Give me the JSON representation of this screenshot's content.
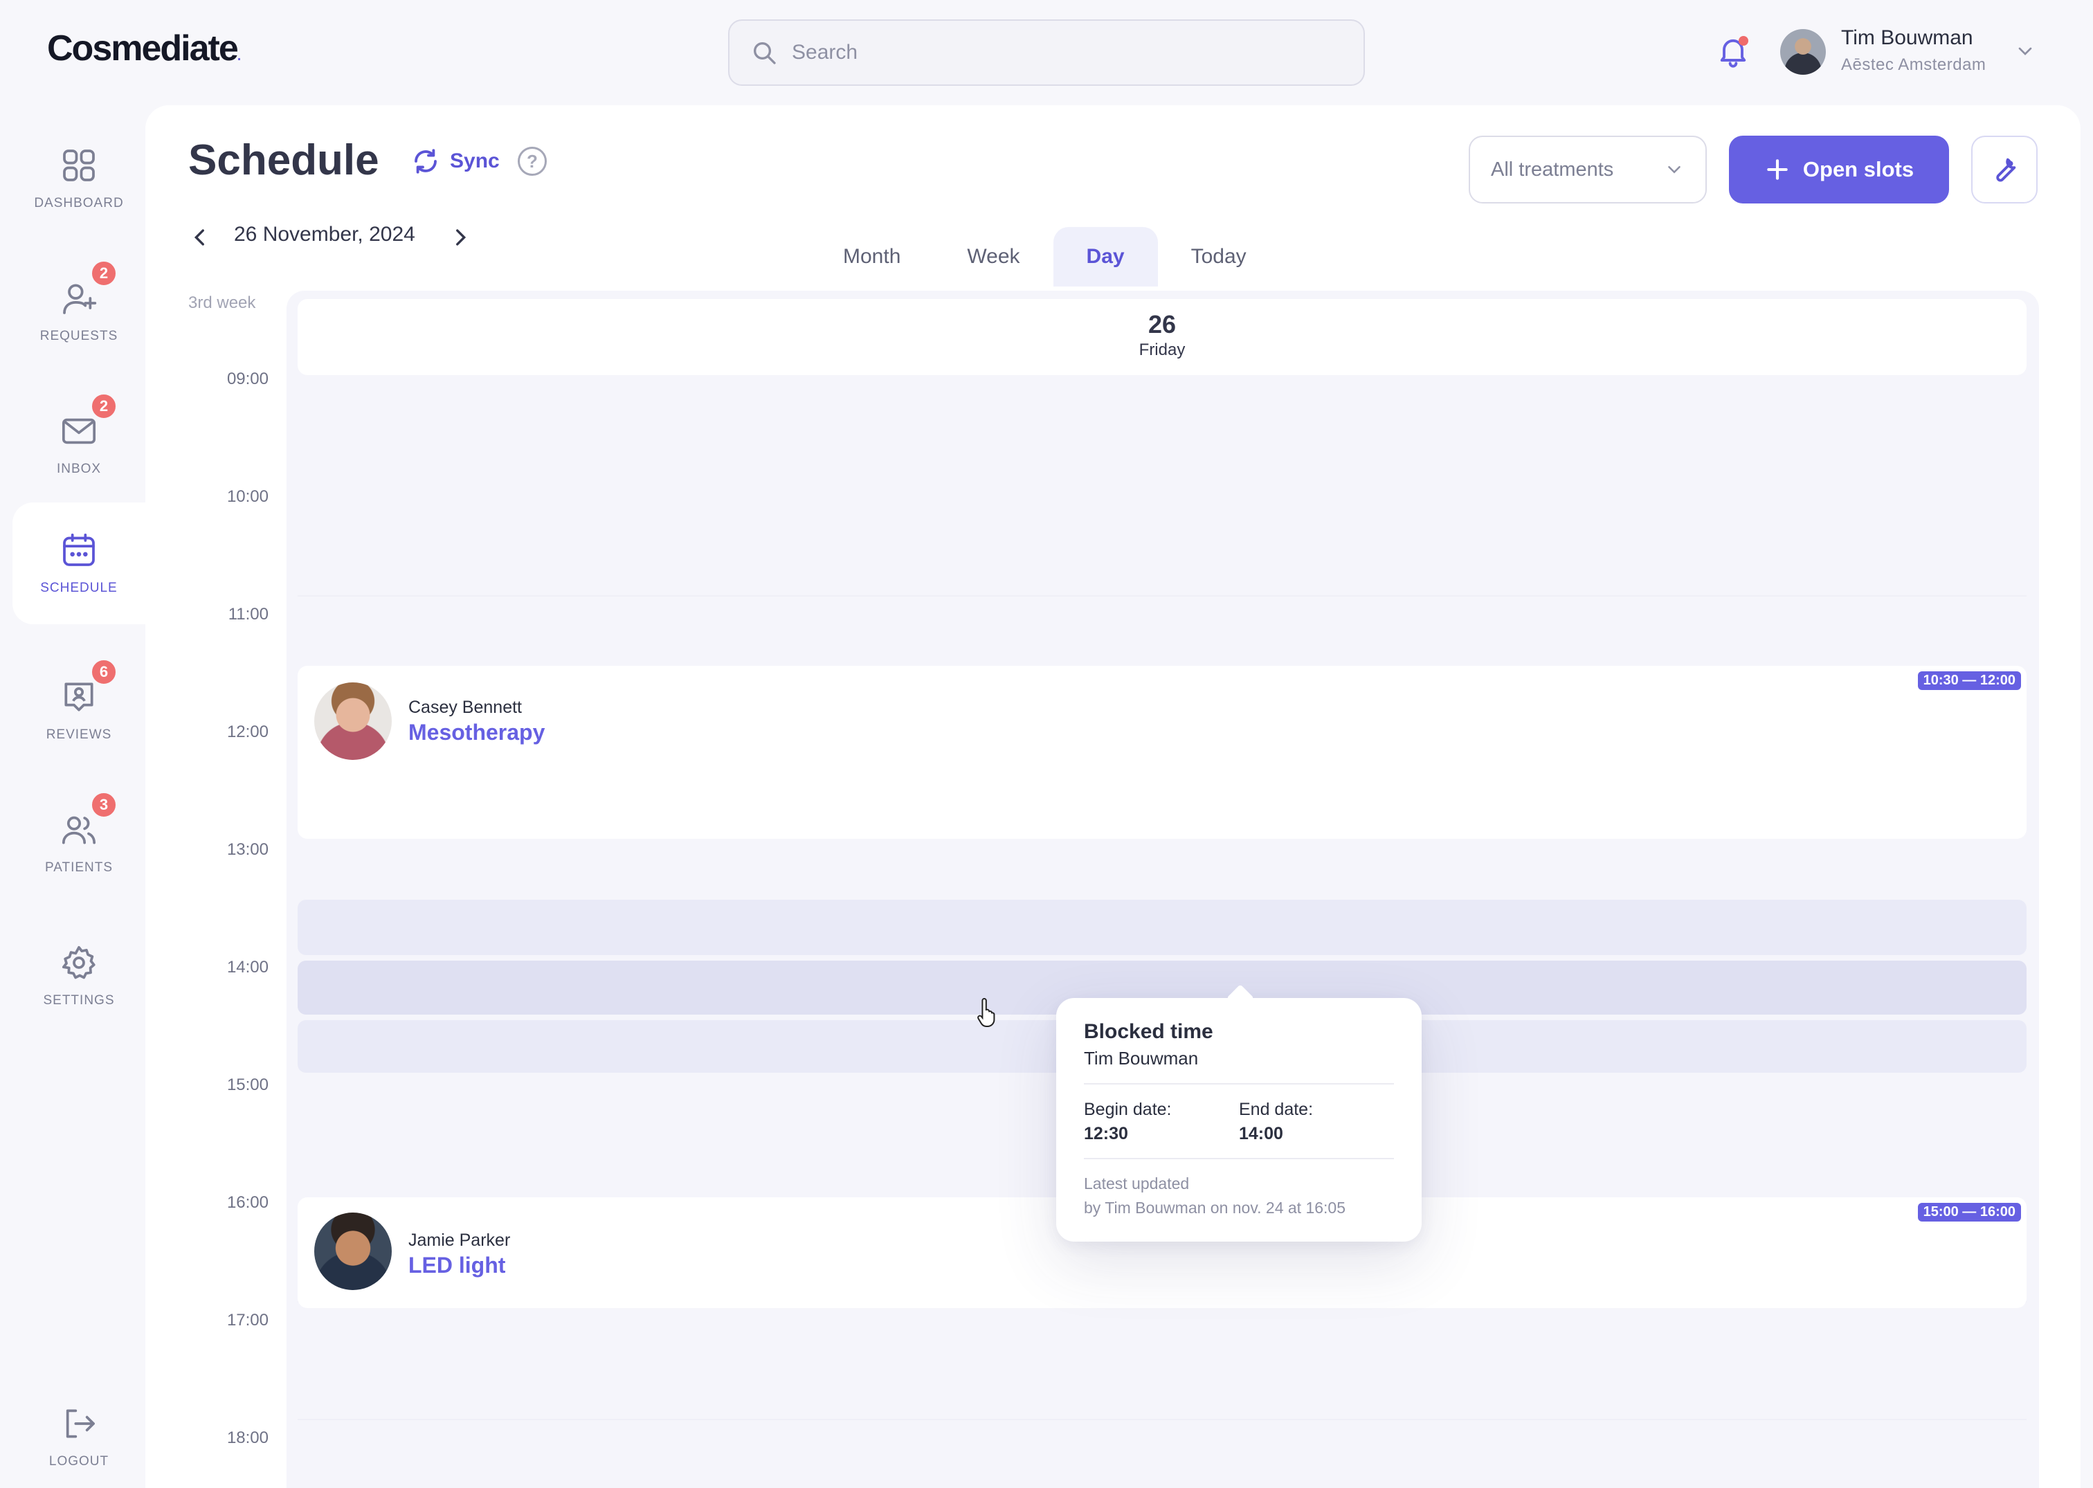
{
  "app": {
    "logo": "Cosmediate",
    "logo_mark": "."
  },
  "search": {
    "placeholder": "Search"
  },
  "user": {
    "name": "Tim Bouwman",
    "org": "Aēstec Amsterdam"
  },
  "sidebar": {
    "items": [
      {
        "label": "DASHBOARD",
        "icon": "grid-icon",
        "badge": null
      },
      {
        "label": "REQUESTS",
        "icon": "user-plus-icon",
        "badge": "2"
      },
      {
        "label": "INBOX",
        "icon": "mail-icon",
        "badge": "2"
      },
      {
        "label": "SCHEDULE",
        "icon": "calendar-icon",
        "badge": null,
        "active": true
      },
      {
        "label": "REVIEWS",
        "icon": "review-icon",
        "badge": "6"
      },
      {
        "label": "PATIENTS",
        "icon": "users-icon",
        "badge": "3"
      },
      {
        "label": "SETTINGS",
        "icon": "gear-icon",
        "badge": null
      }
    ],
    "logout": "LOGOUT"
  },
  "page": {
    "title": "Schedule",
    "sync_label": "Sync",
    "help": "?",
    "date": "26 November, 2024",
    "week_label": "3rd week"
  },
  "tabs": [
    {
      "label": "Month"
    },
    {
      "label": "Week"
    },
    {
      "label": "Day",
      "active": true
    },
    {
      "label": "Today"
    }
  ],
  "filter": {
    "selected": "All treatments"
  },
  "actions": {
    "open_slots": "Open slots"
  },
  "day": {
    "number": "26",
    "weekday": "Friday"
  },
  "time_labels": [
    "09:00",
    "10:00",
    "11:00",
    "12:00",
    "13:00",
    "14:00",
    "15:00",
    "16:00",
    "17:00",
    "18:00"
  ],
  "appointments": [
    {
      "patient": "Casey Bennett",
      "treatment": "Mesotherapy",
      "time": "10:30 — 12:00"
    },
    {
      "patient": "Jamie Parker",
      "treatment": "LED light",
      "time": "15:00 — 16:00"
    }
  ],
  "popover": {
    "title": "Blocked time",
    "by": "Tim Bouwman",
    "begin_label": "Begin date:",
    "begin_value": "12:30",
    "end_label": "End date:",
    "end_value": "14:00",
    "updated_label": "Latest updated",
    "updated_text": "by Tim Bouwman on nov. 24 at 16:05"
  },
  "colors": {
    "accent": "#6660e2",
    "badge": "#ef6f6f",
    "blocked": "#e9eaf7"
  }
}
